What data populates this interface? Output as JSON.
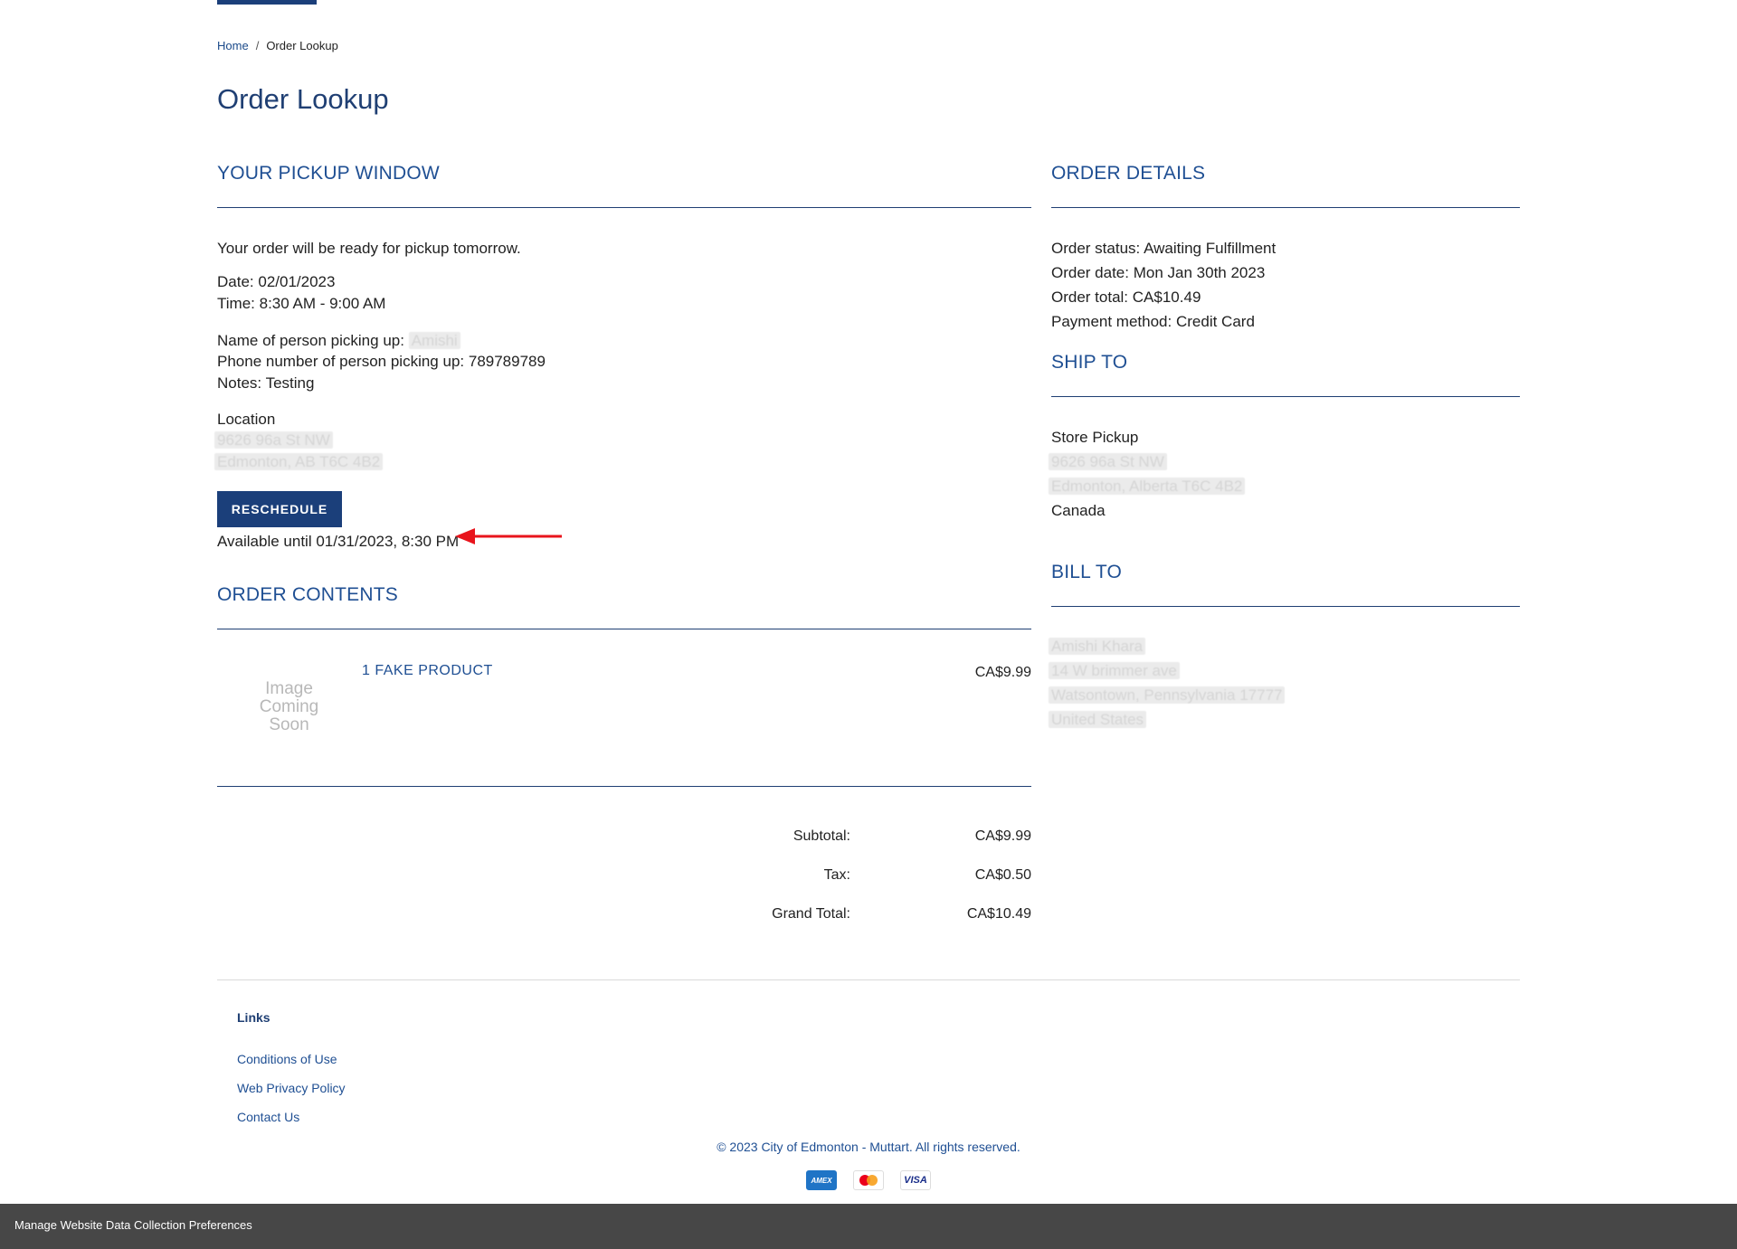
{
  "breadcrumb": {
    "home": "Home",
    "separator": "/",
    "current": "Order Lookup"
  },
  "page_title": "Order Lookup",
  "pickup": {
    "heading": "YOUR PICKUP WINDOW",
    "ready_message": "Your order will be ready for pickup tomorrow.",
    "date_label": "Date:",
    "date_value": "02/01/2023",
    "time_label": "Time:",
    "time_value": "8:30 AM - 9:00 AM",
    "name_label": "Name of person picking up:",
    "name_value": "Amishi",
    "phone_label": "Phone number of person picking up:",
    "phone_value": "789789789",
    "notes_label": "Notes:",
    "notes_value": "Testing",
    "location_label": "Location",
    "location_line1": "9626 96a St NW",
    "location_line2": "Edmonton, AB T6C 4B2",
    "reschedule_label": "RESCHEDULE",
    "available_until": "Available until 01/31/2023, 8:30 PM"
  },
  "order_contents": {
    "heading": "ORDER CONTENTS",
    "items": [
      {
        "image_placeholder": "Image Coming Soon",
        "name": "1 FAKE PRODUCT",
        "price": "CA$9.99"
      }
    ],
    "subtotal_label": "Subtotal:",
    "subtotal_value": "CA$9.99",
    "tax_label": "Tax:",
    "tax_value": "CA$0.50",
    "grand_total_label": "Grand Total:",
    "grand_total_value": "CA$10.49"
  },
  "order_details": {
    "heading": "ORDER DETAILS",
    "status_label": "Order status:",
    "status_value": "Awaiting Fulfillment",
    "date_label": "Order date:",
    "date_value": "Mon Jan 30th 2023",
    "total_label": "Order total:",
    "total_value": "CA$10.49",
    "payment_label": "Payment method:",
    "payment_value": "Credit Card"
  },
  "ship_to": {
    "heading": "SHIP TO",
    "line1": "Store Pickup",
    "line2": "9626 96a St NW",
    "line3": "Edmonton, Alberta T6C 4B2",
    "line4": "Canada"
  },
  "bill_to": {
    "heading": "BILL TO",
    "line1": "Amishi Khara",
    "line2": "14 W brimmer ave",
    "line3": "Watsontown, Pennsylvania 17777",
    "line4": "United States"
  },
  "footer": {
    "links_heading": "Links",
    "links": [
      "Conditions of Use",
      "Web Privacy Policy",
      "Contact Us"
    ],
    "copyright": "© 2023 City of Edmonton - Muttart. All rights reserved.",
    "cards": {
      "amex": "AMEX",
      "visa": "VISA"
    }
  },
  "cookie_bar": {
    "label": "Manage Website Data Collection Preferences"
  },
  "colors": {
    "brand_blue": "#1b3f7a",
    "link_blue": "#1f4f93",
    "arrow_red": "#e8141c",
    "cookie_bar": "#474747"
  }
}
